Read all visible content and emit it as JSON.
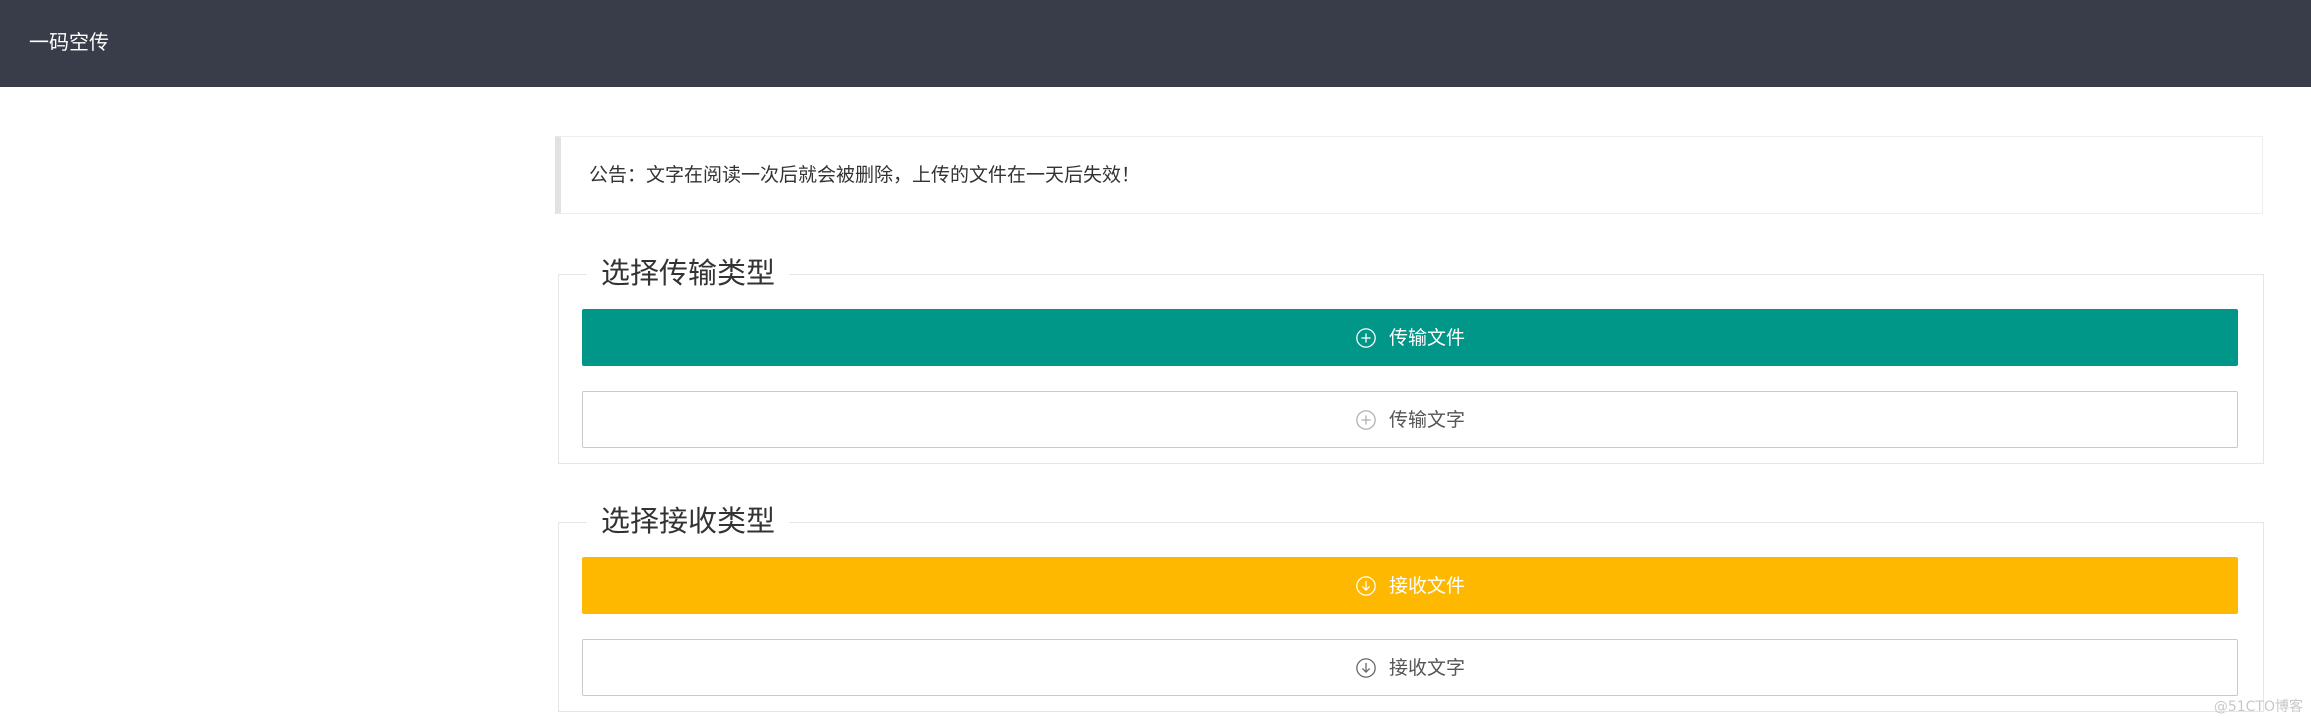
{
  "header": {
    "title": "一码空传"
  },
  "notice": {
    "text": "公告：文字在阅读一次后就会被删除，上传的文件在一天后失效！"
  },
  "send_section": {
    "legend": "选择传输类型",
    "buttons": [
      {
        "label": "传输文件",
        "icon": "plus-circle-icon",
        "style": "primary"
      },
      {
        "label": "传输文字",
        "icon": "plus-circle-icon",
        "style": "plain"
      }
    ]
  },
  "receive_section": {
    "legend": "选择接收类型",
    "buttons": [
      {
        "label": "接收文件",
        "icon": "download-circle-icon",
        "style": "warm"
      },
      {
        "label": "接收文字",
        "icon": "download-circle-icon",
        "style": "plain"
      }
    ]
  },
  "watermark": "@51CTO博客",
  "colors": {
    "header_bg": "#393d49",
    "primary": "#009688",
    "warm": "#ffb800",
    "border": "#c9c9c9"
  }
}
